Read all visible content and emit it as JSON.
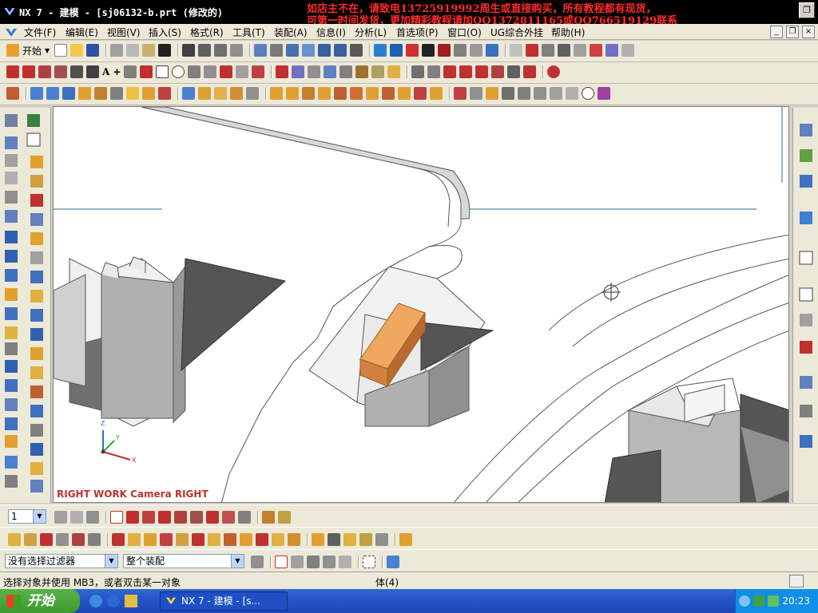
{
  "window": {
    "title": "NX 7 - 建模 - [sj06132-b.prt  (修改的)",
    "watermark_line1": "如店主不在，请致电13725919992周生或直接购买，所有教程都有现货，",
    "watermark_line2": "可第一时间发货，更加精彩教程请加QQ1372811165或QQ766519129联系"
  },
  "menu": {
    "items": [
      "文件(F)",
      "编辑(E)",
      "视图(V)",
      "插入(S)",
      "格式(R)",
      "工具(T)",
      "装配(A)",
      "信息(I)",
      "分析(L)",
      "首选项(P)",
      "窗口(O)",
      "UG综合外挂",
      "帮助(H)"
    ]
  },
  "standard_toolbar": {
    "start_label": "开始"
  },
  "viewport": {
    "view_label": "RIGHT WORK Camera RIGHT",
    "triad_x": "X",
    "triad_y": "Y",
    "triad_z": "Z"
  },
  "selection_bar": {
    "layer_value": "1",
    "filter_value": "没有选择过滤器",
    "scope_value": "整个装配"
  },
  "status": {
    "prompt": "选择对象并使用 MB3，或者双击某一对象",
    "selection_info": "体(4)"
  },
  "taskbar": {
    "start_label": "开始",
    "task_label": "NX 7 - 建模 - [s...",
    "clock": "20:23"
  },
  "colors": {
    "titlebar": "#000000",
    "watermark": "#ff2a2a",
    "highlight_body": "#f0a860",
    "taskbar": "#2456c7",
    "view_label": "#c03030"
  }
}
